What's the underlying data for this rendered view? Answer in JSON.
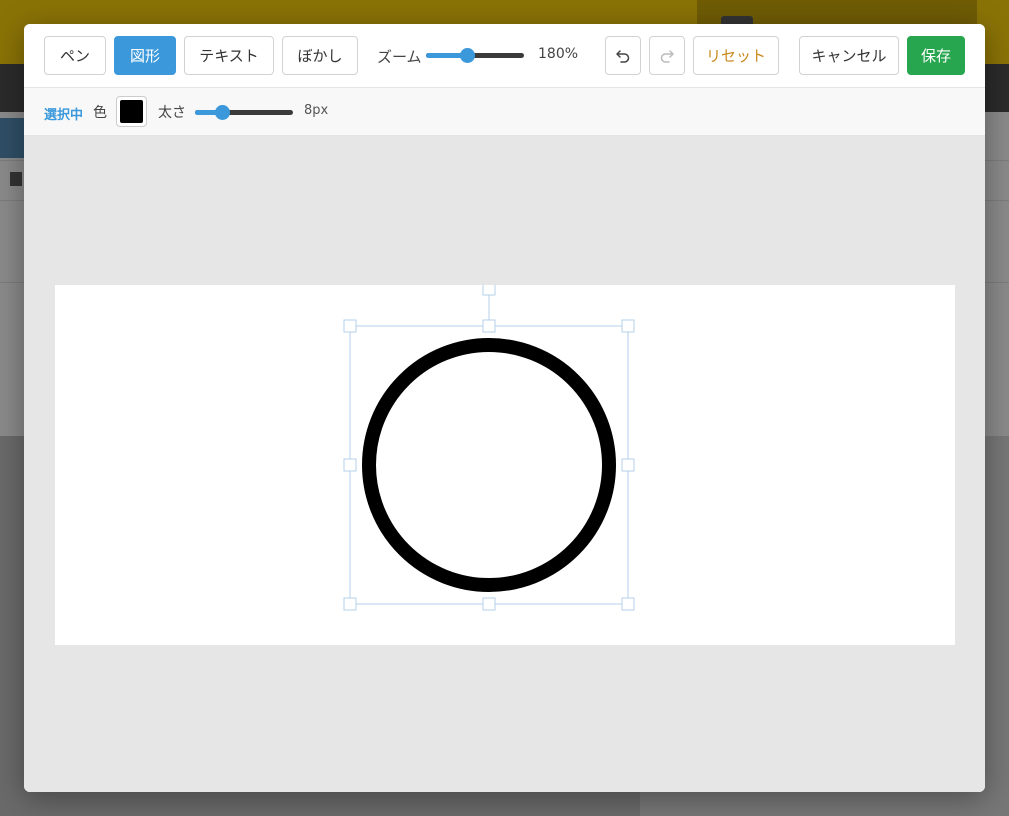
{
  "toolbar": {
    "tools": [
      {
        "label": "ペン",
        "active": false
      },
      {
        "label": "図形",
        "active": true
      },
      {
        "label": "テキスト",
        "active": false
      },
      {
        "label": "ぼかし",
        "active": false
      }
    ],
    "zoom_label": "ズーム",
    "zoom_value": "180%",
    "zoom_level": 0.42,
    "undo_icon": "undo-icon",
    "redo_icon": "redo-icon",
    "reset_label": "リセット",
    "cancel_label": "キャンセル",
    "save_label": "保存"
  },
  "options": {
    "selected_label": "選択中",
    "color_label": "色",
    "color_value": "#000000",
    "width_label": "太さ",
    "width_value": "8px",
    "width_level": 0.28
  },
  "colors": {
    "accent": "#3a98db",
    "save": "#27a64f",
    "reset_text": "#c98a1e",
    "selection_handle": "#b5cfe8"
  }
}
